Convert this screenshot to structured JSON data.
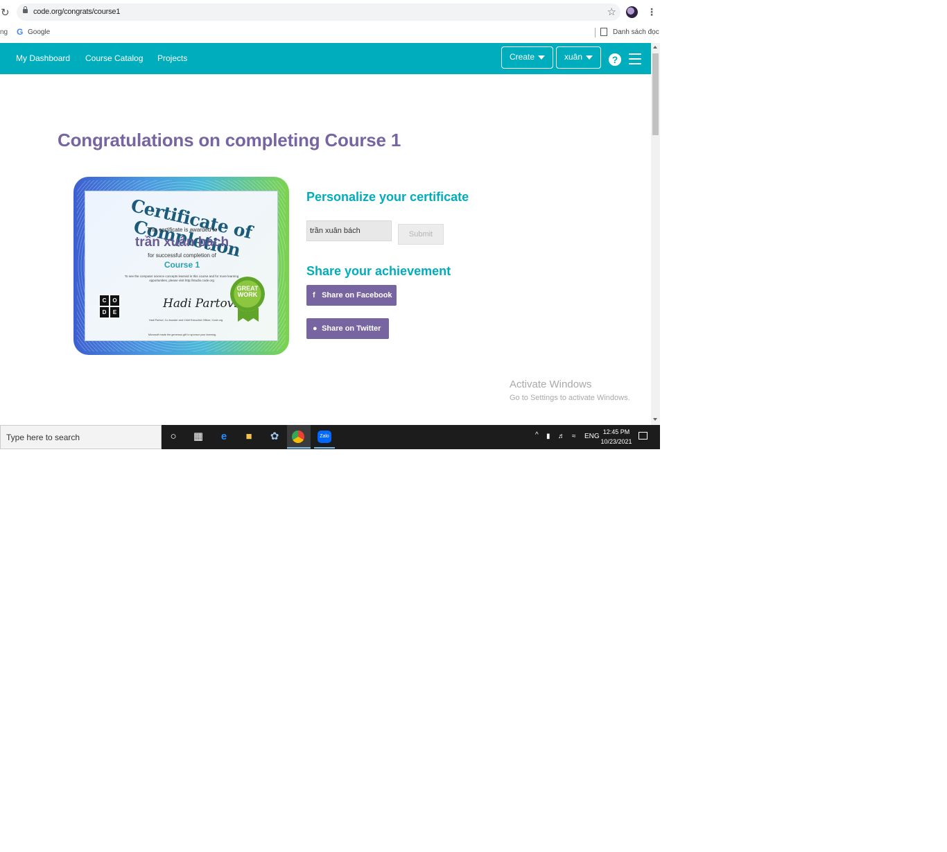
{
  "browser": {
    "url": "code.org/congrats/course1",
    "bookmarks_left_fragment": "ng",
    "bookmark_google": "Google",
    "bookmark_list": "Danh sách đọc"
  },
  "header": {
    "nav": [
      "My Dashboard",
      "Course Catalog",
      "Projects"
    ],
    "create_label": "Create",
    "user_label": "xuân",
    "help_symbol": "?"
  },
  "page": {
    "title": "Congratulations on completing Course 1"
  },
  "certificate": {
    "heading": "Certificate of Completion",
    "awarded_text": "This certificate is awarded to",
    "name": "trần xuân bách",
    "for_text": "for successful completion of",
    "course": "Course 1",
    "info_text": "To see the computer science concepts learned in this course and for more learning opportunities, please visit http://studio.code.org",
    "logo_letters": [
      "C",
      "O",
      "D",
      "E"
    ],
    "signature": "Hadi Partovi",
    "signer_text": "Hadi Partovi, Co-founder and Chief Executive Officer, Code.org",
    "bottom_text": "Microsoft made the generous gift to sponsor your learning.",
    "badge_text": "GREAT WORK"
  },
  "personalize": {
    "title": "Personalize your certificate",
    "input_value": "trần xuân bách",
    "submit_label": "Submit"
  },
  "share": {
    "title": "Share your achievement",
    "facebook_label": "Share on Facebook",
    "twitter_label": "Share on Twitter"
  },
  "watermark": {
    "line1": "Activate Windows",
    "line2": "Go to Settings to activate Windows."
  },
  "taskbar": {
    "search_placeholder": "Type here to search",
    "language": "ENG",
    "time": "12:45 PM",
    "date": "10/23/2021"
  },
  "colors": {
    "header_bg": "#00adbc",
    "title_purple": "#7665a0",
    "accent_teal": "#00adbc",
    "button_purple": "#7665a0"
  }
}
